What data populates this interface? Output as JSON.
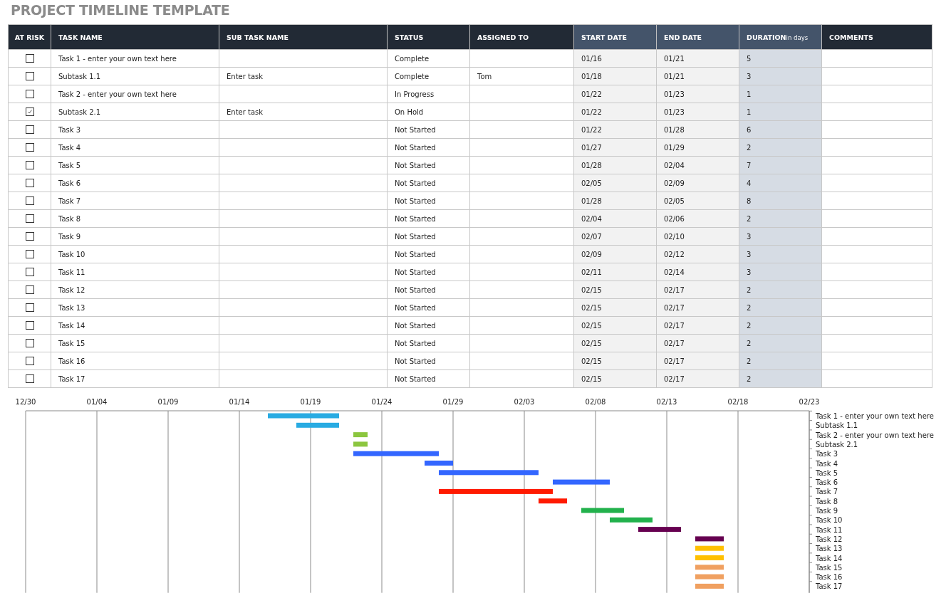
{
  "title": "PROJECT TIMELINE TEMPLATE",
  "table": {
    "columns": [
      {
        "label": "AT RISK",
        "kind": "dark"
      },
      {
        "label": "TASK NAME",
        "kind": "dark"
      },
      {
        "label": "SUB TASK NAME",
        "kind": "dark"
      },
      {
        "label": "STATUS",
        "kind": "dark"
      },
      {
        "label": "ASSIGNED TO",
        "kind": "dark"
      },
      {
        "label": "START DATE",
        "kind": "date"
      },
      {
        "label": "END DATE",
        "kind": "date"
      },
      {
        "label": "DURATION",
        "note": "in days",
        "kind": "duration"
      },
      {
        "label": "COMMENTS",
        "kind": "dark"
      }
    ],
    "rows": [
      {
        "at_risk": false,
        "task": "Task 1 - enter your own text here",
        "subtask": "",
        "status": "Complete",
        "assigned": "",
        "start": "01/16",
        "end": "01/21",
        "duration": "5"
      },
      {
        "at_risk": false,
        "task": "Subtask 1.1",
        "subtask": "Enter task",
        "status": "Complete",
        "assigned": "Tom",
        "start": "01/18",
        "end": "01/21",
        "duration": "3"
      },
      {
        "at_risk": false,
        "task": "Task 2 - enter your own text here",
        "subtask": "",
        "status": "In Progress",
        "assigned": "",
        "start": "01/22",
        "end": "01/23",
        "duration": "1"
      },
      {
        "at_risk": true,
        "task": "Subtask 2.1",
        "subtask": "Enter task",
        "status": "On Hold",
        "assigned": "",
        "start": "01/22",
        "end": "01/23",
        "duration": "1"
      },
      {
        "at_risk": false,
        "task": "Task 3",
        "subtask": "",
        "status": "Not Started",
        "assigned": "",
        "start": "01/22",
        "end": "01/28",
        "duration": "6"
      },
      {
        "at_risk": false,
        "task": "Task 4",
        "subtask": "",
        "status": "Not Started",
        "assigned": "",
        "start": "01/27",
        "end": "01/29",
        "duration": "2"
      },
      {
        "at_risk": false,
        "task": "Task 5",
        "subtask": "",
        "status": "Not Started",
        "assigned": "",
        "start": "01/28",
        "end": "02/04",
        "duration": "7"
      },
      {
        "at_risk": false,
        "task": "Task 6",
        "subtask": "",
        "status": "Not Started",
        "assigned": "",
        "start": "02/05",
        "end": "02/09",
        "duration": "4"
      },
      {
        "at_risk": false,
        "task": "Task 7",
        "subtask": "",
        "status": "Not Started",
        "assigned": "",
        "start": "01/28",
        "end": "02/05",
        "duration": "8"
      },
      {
        "at_risk": false,
        "task": "Task 8",
        "subtask": "",
        "status": "Not Started",
        "assigned": "",
        "start": "02/04",
        "end": "02/06",
        "duration": "2"
      },
      {
        "at_risk": false,
        "task": "Task 9",
        "subtask": "",
        "status": "Not Started",
        "assigned": "",
        "start": "02/07",
        "end": "02/10",
        "duration": "3"
      },
      {
        "at_risk": false,
        "task": "Task 10",
        "subtask": "",
        "status": "Not Started",
        "assigned": "",
        "start": "02/09",
        "end": "02/12",
        "duration": "3"
      },
      {
        "at_risk": false,
        "task": "Task 11",
        "subtask": "",
        "status": "Not Started",
        "assigned": "",
        "start": "02/11",
        "end": "02/14",
        "duration": "3"
      },
      {
        "at_risk": false,
        "task": "Task 12",
        "subtask": "",
        "status": "Not Started",
        "assigned": "",
        "start": "02/15",
        "end": "02/17",
        "duration": "2"
      },
      {
        "at_risk": false,
        "task": "Task 13",
        "subtask": "",
        "status": "Not Started",
        "assigned": "",
        "start": "02/15",
        "end": "02/17",
        "duration": "2"
      },
      {
        "at_risk": false,
        "task": "Task 14",
        "subtask": "",
        "status": "Not Started",
        "assigned": "",
        "start": "02/15",
        "end": "02/17",
        "duration": "2"
      },
      {
        "at_risk": false,
        "task": "Task 15",
        "subtask": "",
        "status": "Not Started",
        "assigned": "",
        "start": "02/15",
        "end": "02/17",
        "duration": "2"
      },
      {
        "at_risk": false,
        "task": "Task 16",
        "subtask": "",
        "status": "Not Started",
        "assigned": "",
        "start": "02/15",
        "end": "02/17",
        "duration": "2"
      },
      {
        "at_risk": false,
        "task": "Task 17",
        "subtask": "",
        "status": "Not Started",
        "assigned": "",
        "start": "02/15",
        "end": "02/17",
        "duration": "2"
      }
    ]
  },
  "timeline": {
    "axis_labels": [
      "12/30",
      "01/04",
      "01/09",
      "01/14",
      "01/19",
      "01/24",
      "01/29",
      "02/03",
      "02/08",
      "02/13",
      "02/18",
      "02/23"
    ],
    "tasks": [
      {
        "label": "Task 1 - enter your own text here",
        "color": "#29abe2"
      },
      {
        "label": "Subtask 1.1",
        "color": "#29abe2"
      },
      {
        "label": "Task 2 - enter your own text here",
        "color": "#8cc63f"
      },
      {
        "label": "Subtask 2.1",
        "color": "#8cc63f"
      },
      {
        "label": "Task 3",
        "color": "#3366ff"
      },
      {
        "label": "Task 4",
        "color": "#3366ff"
      },
      {
        "label": "Task 5",
        "color": "#3366ff"
      },
      {
        "label": "Task 6",
        "color": "#3366ff"
      },
      {
        "label": "Task 7",
        "color": "#ff1a00"
      },
      {
        "label": "Task 8",
        "color": "#ff1a00"
      },
      {
        "label": "Task 9",
        "color": "#22b14c"
      },
      {
        "label": "Task 10",
        "color": "#22b14c"
      },
      {
        "label": "Task 11",
        "color": "#660050"
      },
      {
        "label": "Task 12",
        "color": "#660050"
      },
      {
        "label": "Task 13",
        "color": "#ffc000"
      },
      {
        "label": "Task 14",
        "color": "#ffc000"
      },
      {
        "label": "Task 15",
        "color": "#f0a060"
      },
      {
        "label": "Task 16",
        "color": "#f0a060"
      },
      {
        "label": "Task 17",
        "color": "#f0a060"
      }
    ]
  }
}
